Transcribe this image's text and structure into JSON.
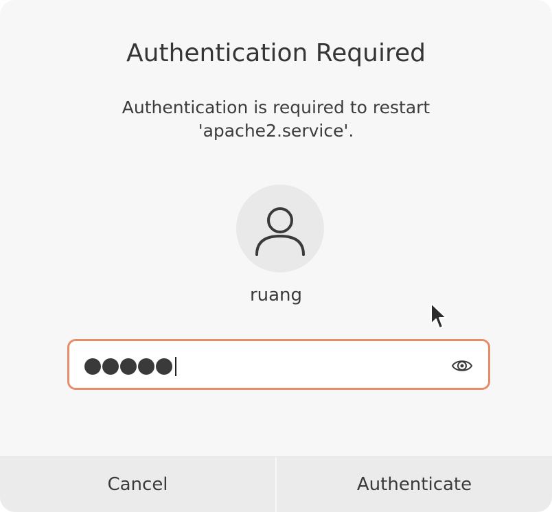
{
  "dialog": {
    "title": "Authentication Required",
    "message": "Authentication is required to restart 'apache2.service'."
  },
  "user": {
    "avatar_icon": "user-icon",
    "username": "ruang"
  },
  "password_field": {
    "masked_length": 5,
    "reveal_icon": "eye-icon",
    "border_color": "#e68c6b"
  },
  "buttons": {
    "cancel_label": "Cancel",
    "authenticate_label": "Authenticate"
  }
}
